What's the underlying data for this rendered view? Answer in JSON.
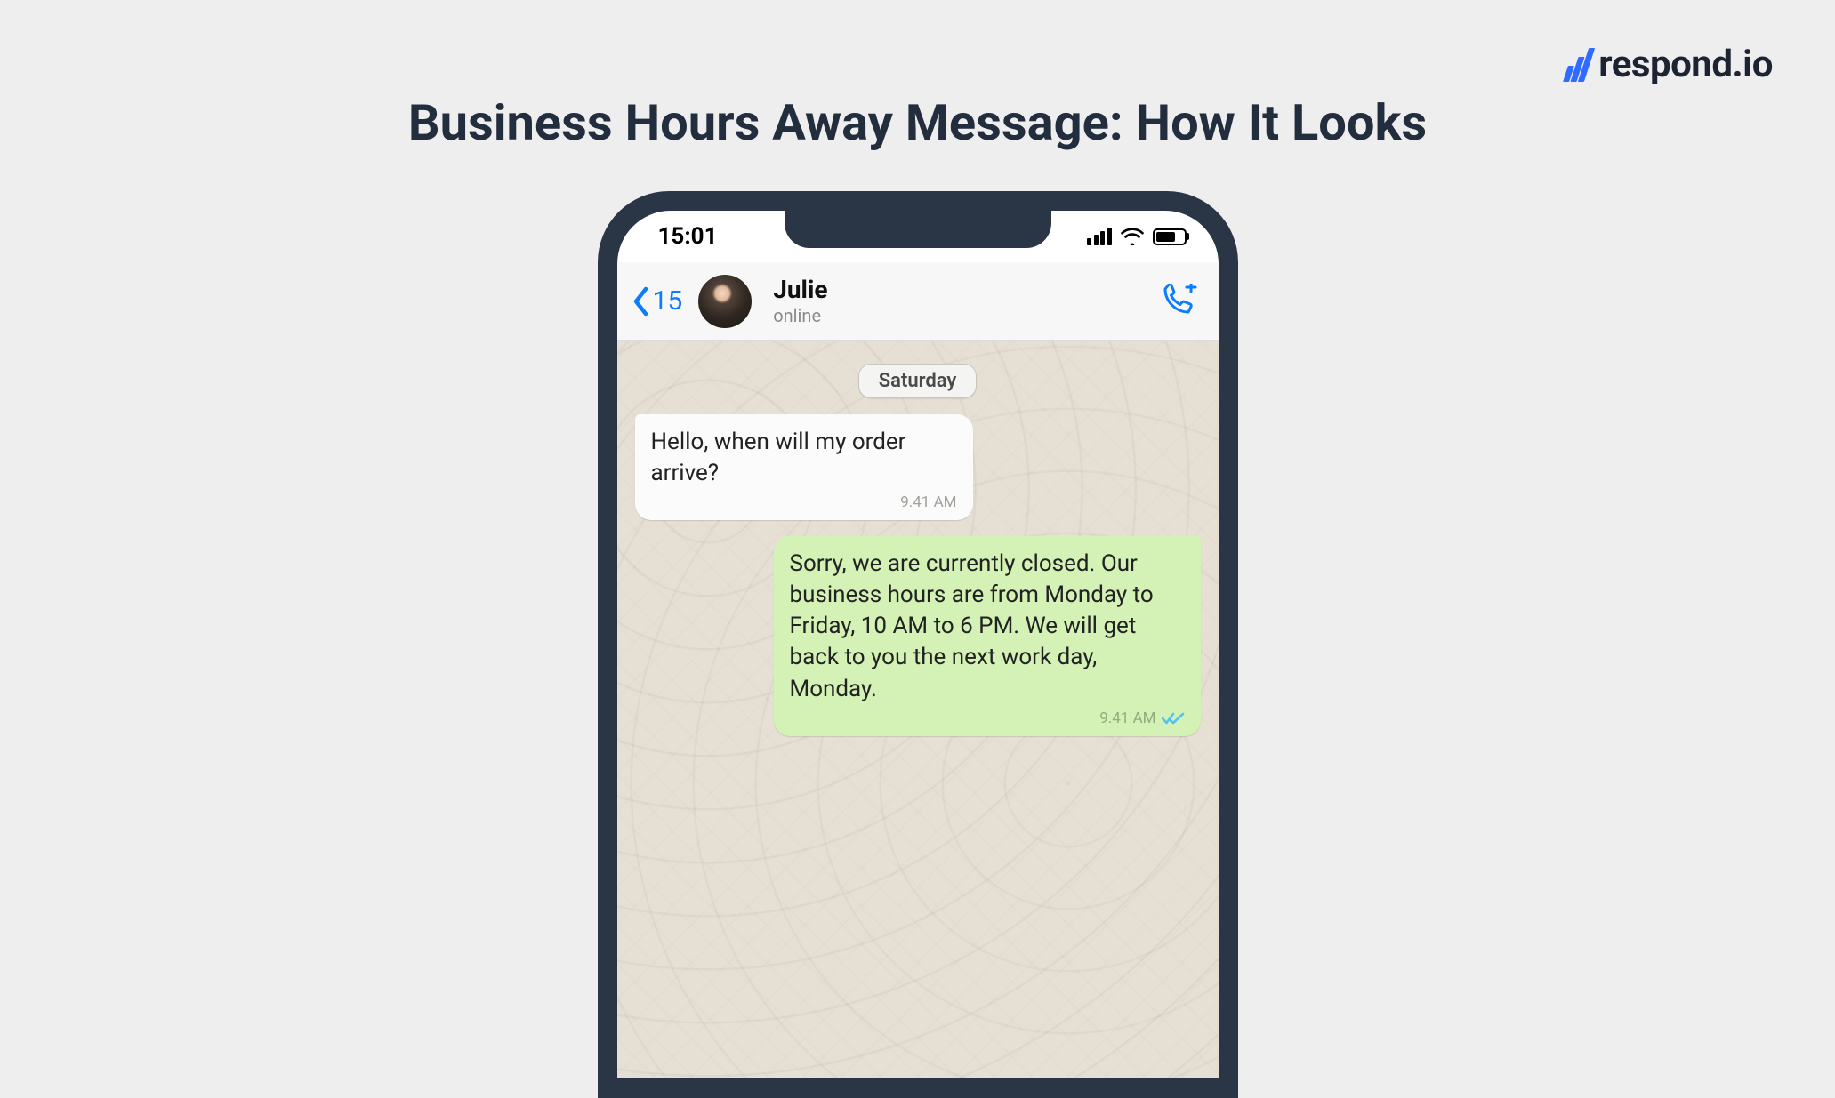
{
  "brand": {
    "name": "respond.io"
  },
  "title": "Business Hours Away Message: How It Looks",
  "phone": {
    "status": {
      "time": "15:01"
    },
    "header": {
      "back_count": "15",
      "contact_name": "Julie",
      "contact_status": "online"
    },
    "chat": {
      "date_label": "Saturday",
      "messages": [
        {
          "direction": "in",
          "text": "Hello, when will my order arrive?",
          "time": "9.41 AM"
        },
        {
          "direction": "out",
          "text": "Sorry, we are currently closed. Our business hours are from Monday to Friday, 10 AM to 6 PM. We will get back to you the next work day, Monday.",
          "time": "9.41 AM"
        }
      ]
    }
  }
}
